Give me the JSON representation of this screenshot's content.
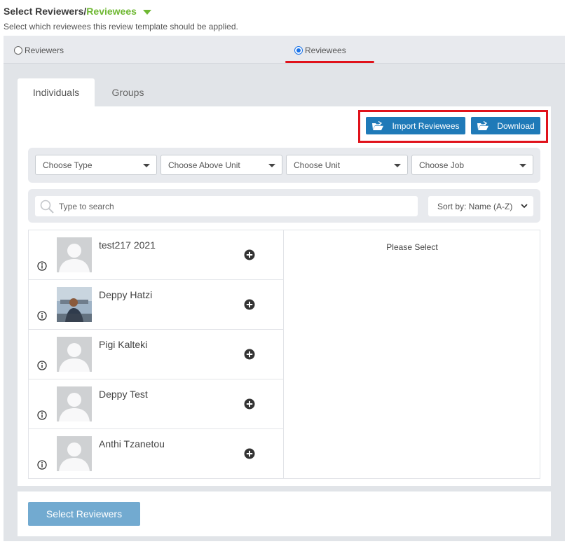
{
  "header": {
    "title_part1": "Select Reviewers/",
    "title_part2": "Reviewees",
    "description": "Select which reviewees this review template should be applied."
  },
  "mode": {
    "reviewers_label": "Reviewers",
    "reviewees_label": "Reviewees",
    "selected": "Reviewees"
  },
  "tabs": [
    {
      "label": "Individuals",
      "active": true
    },
    {
      "label": "Groups",
      "active": false
    }
  ],
  "actions": {
    "import_label": "Import Reviewees",
    "download_label": "Download"
  },
  "filters": [
    {
      "value": "Choose Type"
    },
    {
      "value": "Choose Above Unit"
    },
    {
      "value": "Choose Unit"
    },
    {
      "value": "Choose Job"
    }
  ],
  "search": {
    "placeholder": "Type to search",
    "sort_value": "Sort by: Name (A-Z)"
  },
  "people": [
    {
      "name": "test217 2021",
      "avatar": "default-avatar"
    },
    {
      "name": "Deppy Hatzi",
      "avatar": "photo-avatar"
    },
    {
      "name": "Pigi Kalteki",
      "avatar": "default-avatar"
    },
    {
      "name": "Deppy Test",
      "avatar": "default-avatar"
    },
    {
      "name": "Anthi Tzanetou",
      "avatar": "default-avatar"
    }
  ],
  "selected_panel": {
    "empty_text": "Please Select"
  },
  "footer": {
    "button_label": "Select Reviewers"
  },
  "colors": {
    "accent_green": "#6fb833",
    "primary_blue": "#1f7ab8",
    "highlight_red": "#e0121b",
    "disabled_blue": "#72aad0"
  }
}
